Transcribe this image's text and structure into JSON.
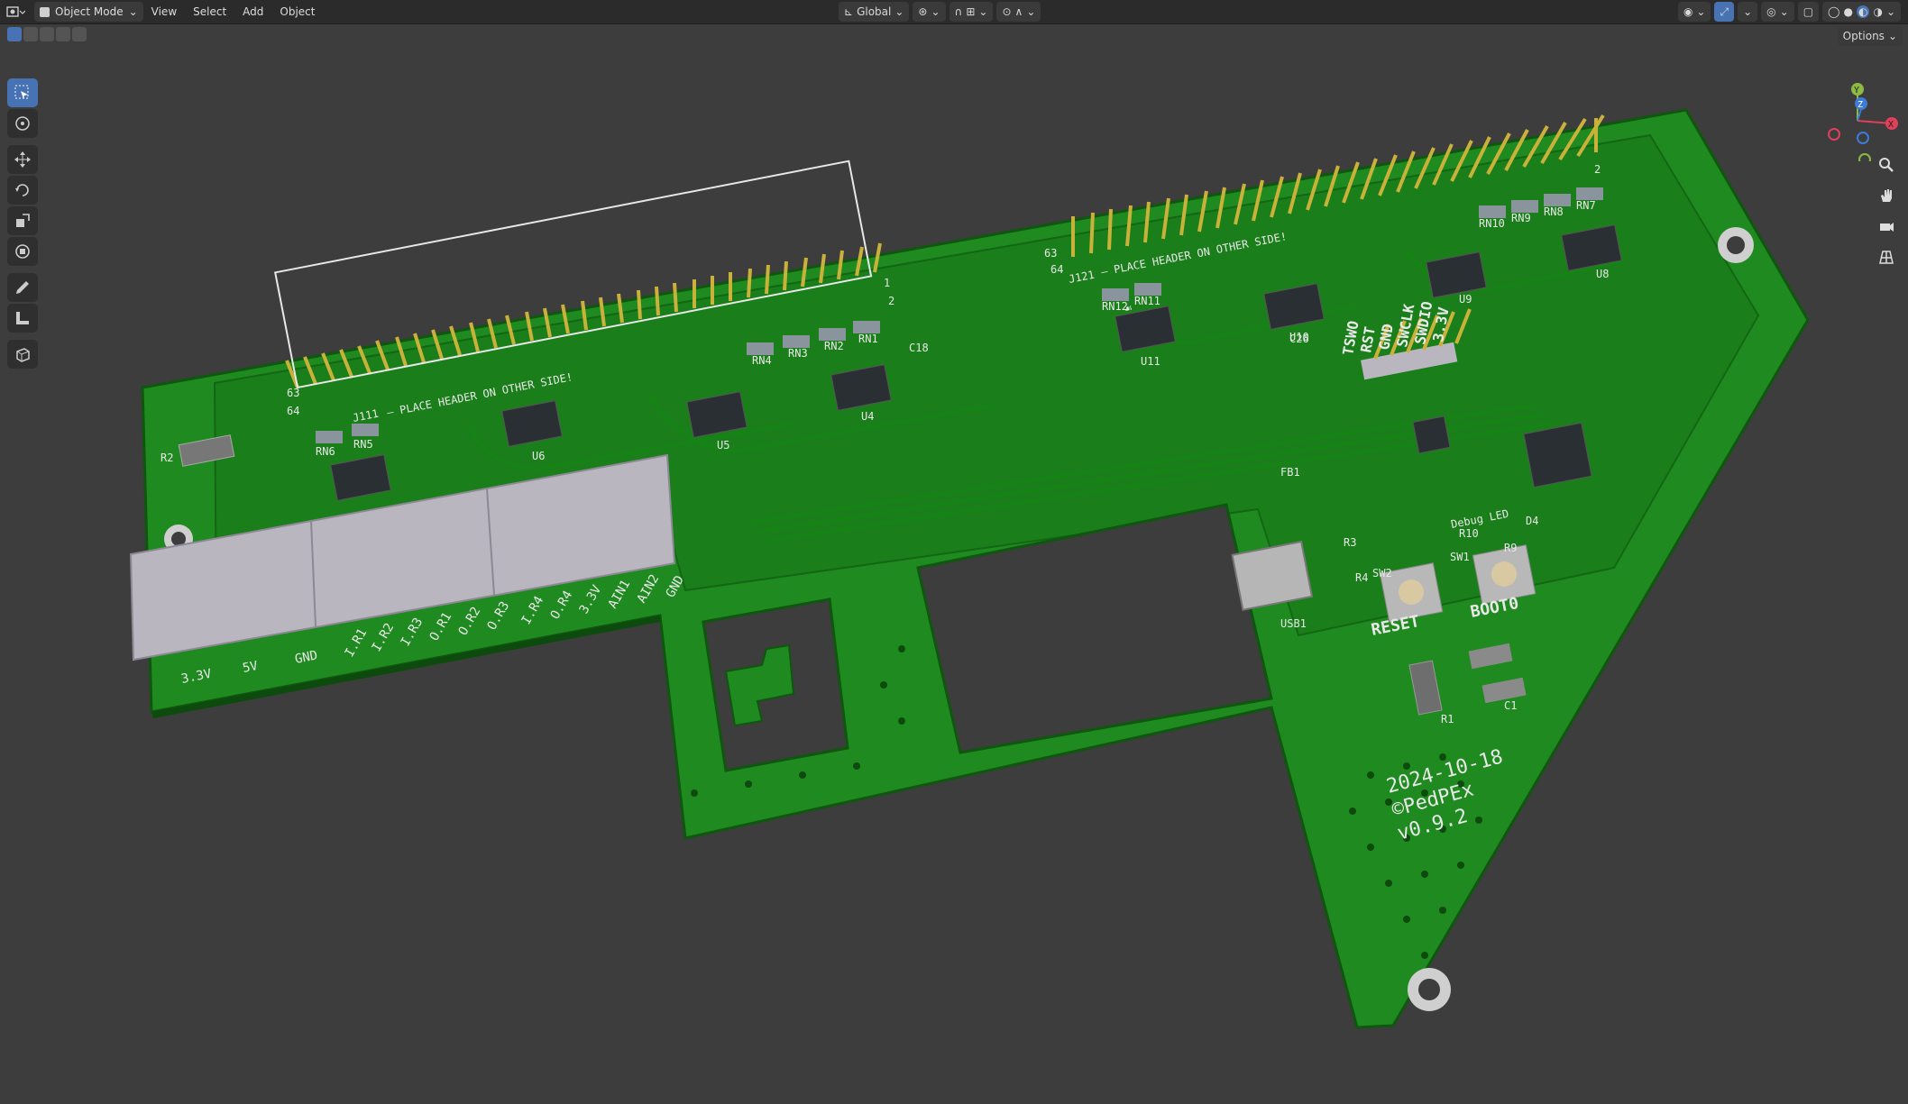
{
  "header": {
    "mode_label": "Object Mode",
    "menus": [
      "View",
      "Select",
      "Add",
      "Object"
    ],
    "transform_orientation": "Global",
    "options_label": "Options"
  },
  "board": {
    "connector_left": "J111",
    "connector_right": "J121",
    "header_note": "– PLACE HEADER ON OTHER SIDE!",
    "pin1": "1",
    "pin2": "2",
    "pin63": "63",
    "pin64": "64",
    "terminal_labels_a": [
      "3.3V",
      "5V",
      "GND"
    ],
    "terminal_labels_b": [
      "I.R1",
      "I.R2",
      "I.R3",
      "O.R1",
      "O.R2",
      "O.R3"
    ],
    "terminal_labels_c": [
      "I.R4",
      "O.R4",
      "3.3V",
      "AIN1",
      "AIN2",
      "GND"
    ],
    "debug_labels": [
      "TSWO",
      "RST",
      "GND",
      "SWCLK",
      "SWDIO",
      "3.3V"
    ],
    "chip_labels": [
      "U6",
      "U5",
      "U4",
      "U11",
      "U10",
      "U9",
      "U8"
    ],
    "rn_labels": [
      "RN6",
      "RN5",
      "RN4",
      "RN3",
      "RN2",
      "RN1",
      "RN12",
      "RN11",
      "RN10",
      "RN9",
      "RN8",
      "RN7"
    ],
    "misc_labels": [
      "R2",
      "R1",
      "C1",
      "USB1",
      "FB1",
      "SW2",
      "SW1",
      "R3",
      "R4",
      "R9",
      "R10",
      "D4",
      "C18",
      "C26"
    ],
    "debug_led": "Debug LED",
    "reset": "RESET",
    "boot": "BOOT0",
    "date": "2024-10-18",
    "author": "©PedPEx",
    "version": "v0.9.2"
  },
  "colors": {
    "viewport": "#3d3d3d",
    "header": "#2b2b2b",
    "pcb": "#1f8a1f",
    "pcb_dark": "#136613",
    "silk": "#e8e8e8",
    "gold": "#c9b13a",
    "accent": "#4772b3"
  }
}
